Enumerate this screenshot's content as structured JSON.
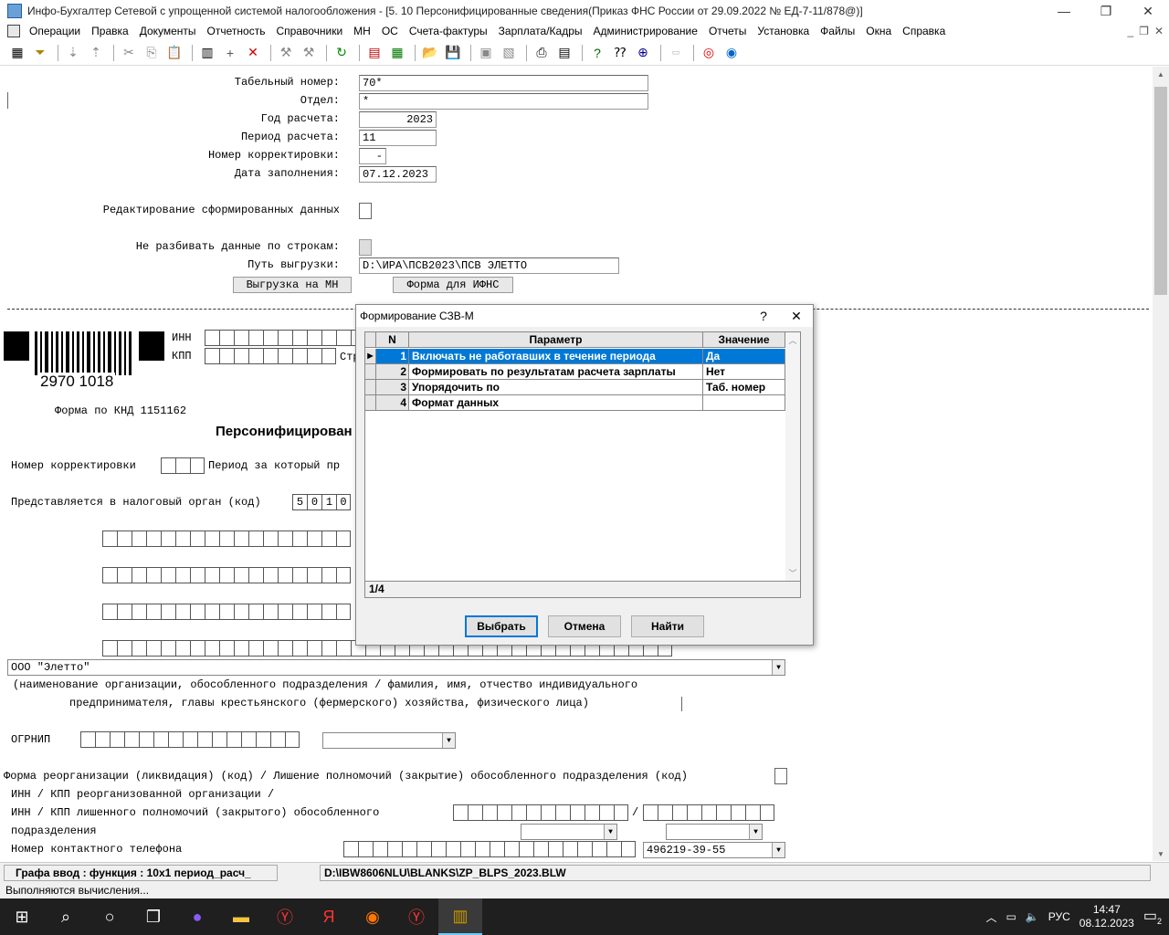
{
  "window": {
    "title": "Инфо-Бухгалтер Сетевой с упрощенной системой налогообложения - [5. 10 Персонифицированные сведения(Приказ ФНС России от 29.09.2022 № ЕД-7-11/878@)]",
    "controls": {
      "minimize": "—",
      "restore": "❐",
      "close": "✕"
    }
  },
  "menu": [
    "Операции",
    "Правка",
    "Документы",
    "Отчетность",
    "Справочники",
    "МН",
    "ОС",
    "Счета-фактуры",
    "Зарплата/Кадры",
    "Администрирование",
    "Отчеты",
    "Установка",
    "Файлы",
    "Окна",
    "Справка"
  ],
  "mdi_controls": {
    "minimize": "_",
    "restore": "❐",
    "close": "✕"
  },
  "form": {
    "tab_number_label": "Табельный номер:",
    "tab_number_value": "70*",
    "dept_label": "Отдел:",
    "dept_value": "*",
    "year_label": "Год расчета:",
    "year_value": "2023",
    "period_label": "Период расчета:",
    "period_value": "11",
    "corr_label": "Номер корректировки:",
    "corr_value": "-",
    "date_label": "Дата заполнения:",
    "date_value": "07.12.2023",
    "edit_label": "Редактирование сформированных данных",
    "nosplit_label": "Не разбивать данные по строкам:",
    "path_label": "Путь выгрузки:",
    "path_value": "D:\\ИРА\\ПСВ2023\\ПСВ ЭЛЕТТО",
    "btn_export_mn": "Выгрузка на МН",
    "btn_form_ifns": "Форма для ИФНС"
  },
  "blank": {
    "barcode_number": "2970 1018",
    "inn_label": "ИНН",
    "kpp_label": "КПП",
    "str_label": "Стр",
    "knd": "Форма по КНД 1151162",
    "heading": "Персонифицирован",
    "corr_number_label": "Номер корректировки",
    "period_label": "Период за который пр",
    "tax_org_label": "Представляется в налоговый орган (код)",
    "tax_org_code": [
      "5",
      "0",
      "1",
      "0"
    ],
    "org_name": "ООО \"Элетто\"",
    "org_caption_1": "(наименование организации, обособленного подразделения  / фамилия, имя, отчество   индивидуального",
    "org_caption_2": "предпринимателя, главы крестьянского (фермерского) хозяйства, физического лица)",
    "ogrnip_label": "ОГРНИП",
    "reorg_label": "Форма реорганизации (ликвидация) (код) / Лишение полномочий (закрытие) обособленного подразделения (код)",
    "inn_kpp_reorg": "ИНН / КПП реорганизованной организации /",
    "inn_kpp_closed": "ИНН / КПП лишенного полномочий (закрытого) обособленного",
    "subdivision": "подразделения",
    "phone_label": "Номер контактного телефона",
    "phone_value": "496219-39-55",
    "slash": "/"
  },
  "status": {
    "left": "Графа  ввод : функция : 10х1  период_расч_",
    "right": "D:\\IBW8606NLU\\BLANKS\\ZP_BLPS_2023.BLW",
    "message": "Выполняются вычисления..."
  },
  "dialog": {
    "title": "Формирование СЗВ-М",
    "help": "?",
    "close": "✕",
    "columns": {
      "n": "N",
      "param": "Параметр",
      "value": "Значение"
    },
    "rows": [
      {
        "n": "1",
        "param": "Включать не работавших в течение периода",
        "value": "Да"
      },
      {
        "n": "2",
        "param": "Формировать по результатам расчета зарплаты",
        "value": "Нет"
      },
      {
        "n": "3",
        "param": "Упорядочить по",
        "value": "Таб. номер"
      },
      {
        "n": "4",
        "param": "Формат данных",
        "value": ""
      }
    ],
    "counter": "1/4",
    "btn_select": "Выбрать",
    "btn_cancel": "Отмена",
    "btn_find": "Найти"
  },
  "taskbar": {
    "lang": "РУС",
    "time": "14:47",
    "date": "08.12.2023",
    "notif_count": "2"
  }
}
